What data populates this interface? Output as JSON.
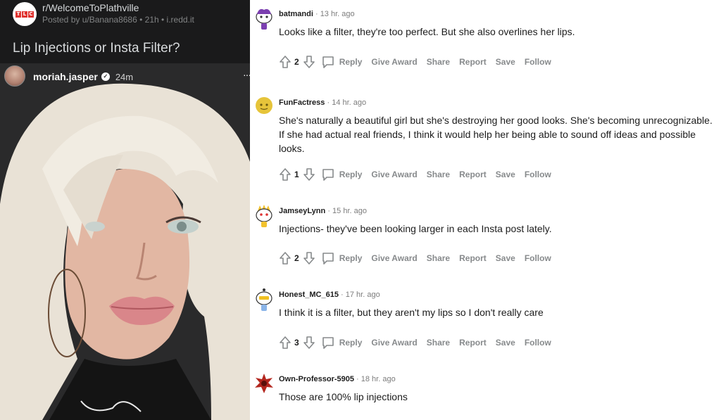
{
  "post": {
    "subreddit": "r/WelcomeToPlathville",
    "subreddit_icon_letters": [
      "T",
      "L",
      "C"
    ],
    "meta": "Posted by u/Banana8686 • 21h • i.redd.it",
    "title": "Lip Injections or Insta Filter?",
    "image": {
      "username": "moriah.jasper",
      "time": "24m",
      "more": "···"
    }
  },
  "comments": [
    {
      "user": "batmandi",
      "time": "· 13 hr. ago",
      "body": "Looks like a filter, they're too perfect. But she also overlines her lips.",
      "votes": "2"
    },
    {
      "user": "FunFactress",
      "time": "· 14 hr. ago",
      "body": "She's naturally a beautiful girl but she's destroying her good looks. She's becoming unrecognizable. If she had actual real friends, I think it would help her being able to sound off ideas and possible looks.",
      "votes": "1"
    },
    {
      "user": "JamseyLynn",
      "time": "· 15 hr. ago",
      "body": "Injections- they've been looking larger in each Insta post lately.",
      "votes": "2"
    },
    {
      "user": "Honest_MC_615",
      "time": "· 17 hr. ago",
      "body": "I think it is a filter, but they aren't my lips so I don't really care",
      "votes": "3"
    },
    {
      "user": "Own-Professor-5905",
      "time": "· 18 hr. ago",
      "body": "Those are 100% lip injections",
      "votes": ""
    }
  ],
  "actions": {
    "reply": "Reply",
    "give_award": "Give Award",
    "share": "Share",
    "report": "Report",
    "save": "Save",
    "follow": "Follow"
  },
  "colors": {
    "dark_bg": "#1a1a1b",
    "muted": "#878a8c",
    "tlc_red": "#e0332f"
  }
}
